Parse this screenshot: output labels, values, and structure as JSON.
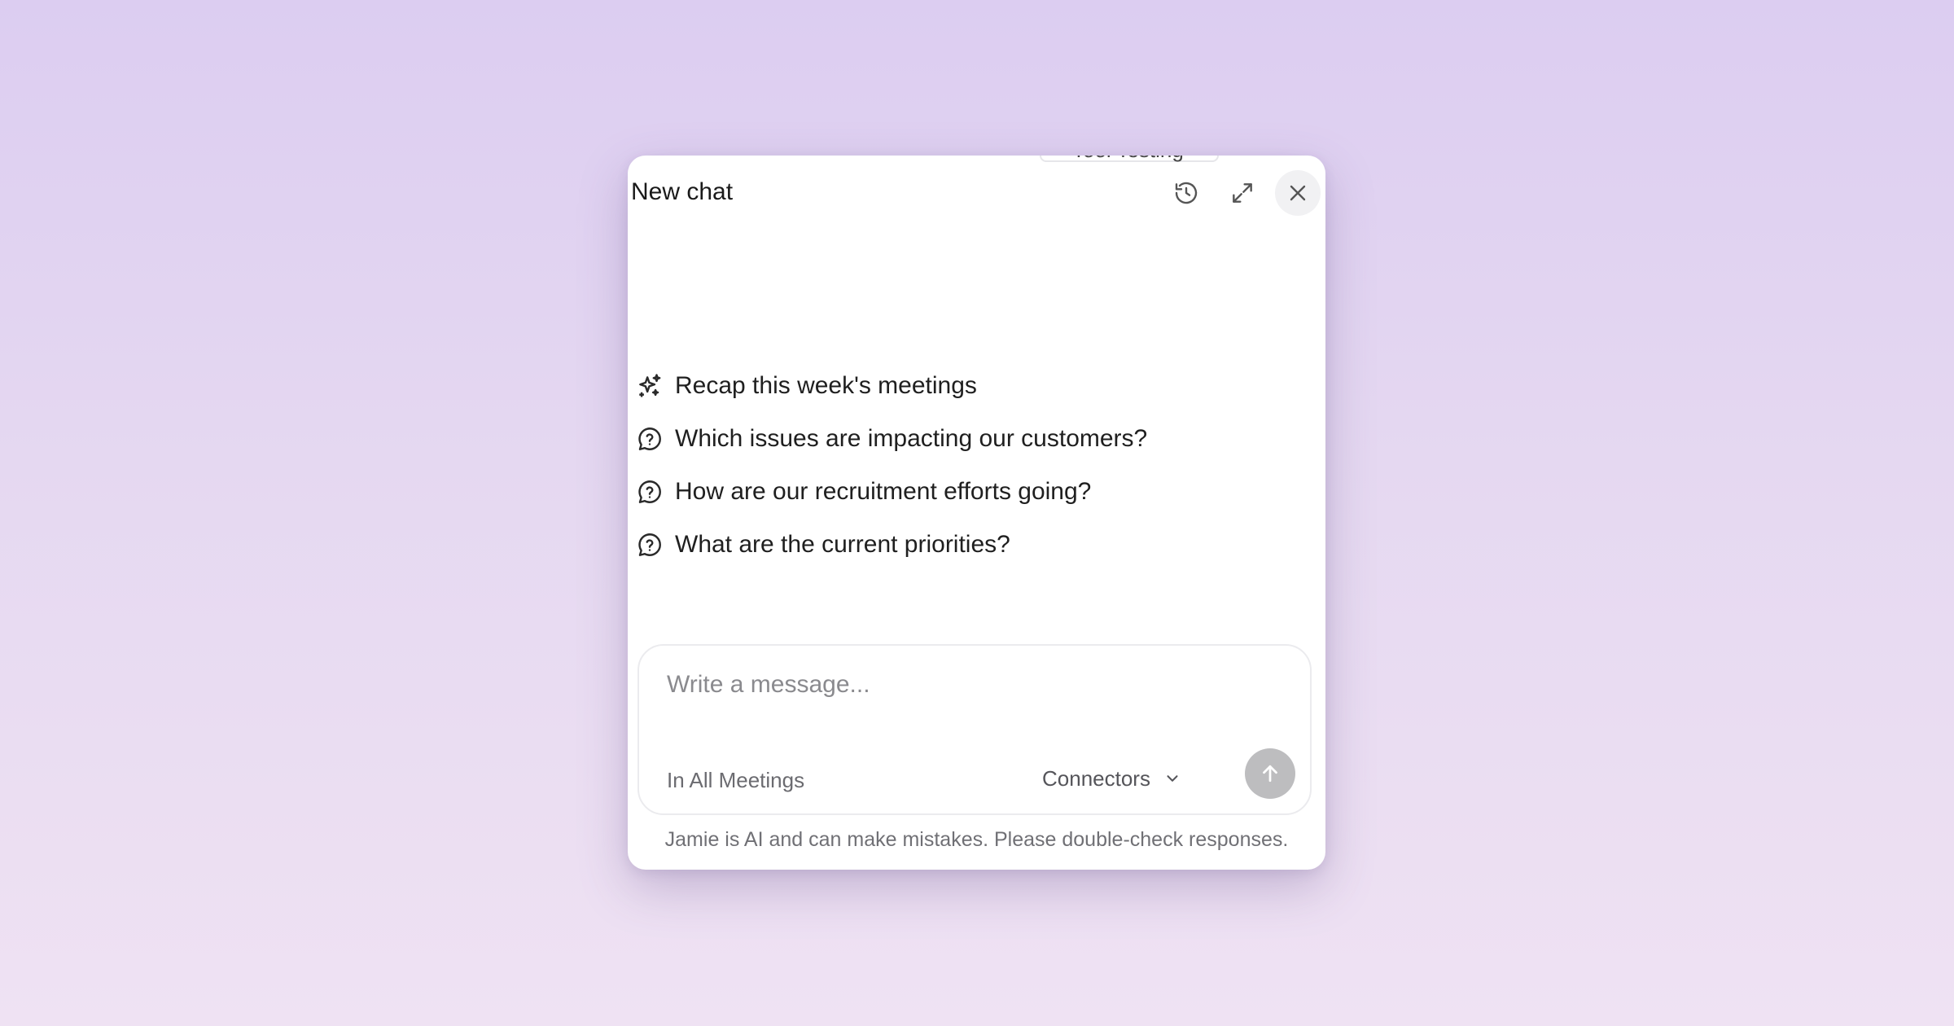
{
  "chat": {
    "peek_tab": "Tool Testing",
    "title": "New chat",
    "history_label": "History",
    "expand_label": "Expand",
    "close_label": "Close"
  },
  "suggestions": [
    {
      "icon": "sparkles-icon",
      "text": "Recap this week's meetings"
    },
    {
      "icon": "question-bubble-icon",
      "text": "Which issues are impacting our customers?"
    },
    {
      "icon": "question-bubble-icon",
      "text": "How are our recruitment efforts going?"
    },
    {
      "icon": "question-bubble-icon",
      "text": "What are the current priorities?"
    }
  ],
  "composer": {
    "value": "",
    "placeholder": "Write a message...",
    "scope": "In All Meetings",
    "connectors_label": "Connectors",
    "send_color": "#bdbdbf"
  },
  "footer": {
    "disclaimer": "Jamie is AI and can make mistakes. Please double-check responses."
  },
  "colors": {
    "background_top": "#dccdf1",
    "background_bottom": "#efe2f3",
    "panel": "#ffffff"
  }
}
